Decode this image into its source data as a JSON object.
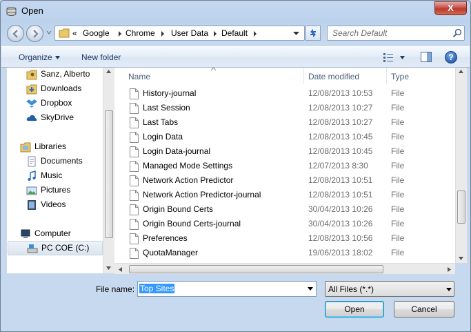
{
  "window": {
    "title": "Open",
    "close_glyph": "X"
  },
  "address": {
    "breadcrumb": [
      "«",
      "Google",
      "Chrome",
      "User Data",
      "Default"
    ]
  },
  "search": {
    "placeholder": "Search Default"
  },
  "toolbar": {
    "organize_label": "Organize",
    "new_folder_label": "New folder",
    "help_glyph": "?"
  },
  "nav": {
    "items": [
      {
        "label": "Sanz, Alberto",
        "icon": "user-folder-icon"
      },
      {
        "label": "Downloads",
        "icon": "downloads-icon"
      },
      {
        "label": "Dropbox",
        "icon": "dropbox-icon"
      },
      {
        "label": "SkyDrive",
        "icon": "skydrive-icon"
      },
      {
        "label": "Libraries",
        "icon": "libraries-icon"
      },
      {
        "label": "Documents",
        "icon": "documents-icon"
      },
      {
        "label": "Music",
        "icon": "music-icon"
      },
      {
        "label": "Pictures",
        "icon": "pictures-icon"
      },
      {
        "label": "Videos",
        "icon": "videos-icon"
      },
      {
        "label": "Computer",
        "icon": "computer-icon"
      },
      {
        "label": "PC COE (C:)",
        "icon": "drive-icon"
      }
    ]
  },
  "columns": {
    "name": "Name",
    "date": "Date modified",
    "type": "Type"
  },
  "files": [
    {
      "name": "History-journal",
      "date": "12/08/2013 10:53",
      "type": "File"
    },
    {
      "name": "Last Session",
      "date": "12/08/2013 10:27",
      "type": "File"
    },
    {
      "name": "Last Tabs",
      "date": "12/08/2013 10:27",
      "type": "File"
    },
    {
      "name": "Login Data",
      "date": "12/08/2013 10:45",
      "type": "File"
    },
    {
      "name": "Login Data-journal",
      "date": "12/08/2013 10:45",
      "type": "File"
    },
    {
      "name": "Managed Mode Settings",
      "date": "12/07/2013 8:30",
      "type": "File"
    },
    {
      "name": "Network Action Predictor",
      "date": "12/08/2013 10:51",
      "type": "File"
    },
    {
      "name": "Network Action Predictor-journal",
      "date": "12/08/2013 10:51",
      "type": "File"
    },
    {
      "name": "Origin Bound Certs",
      "date": "30/04/2013 10:26",
      "type": "File"
    },
    {
      "name": "Origin Bound Certs-journal",
      "date": "30/04/2013 10:26",
      "type": "File"
    },
    {
      "name": "Preferences",
      "date": "12/08/2013 10:56",
      "type": "File"
    },
    {
      "name": "QuotaManager",
      "date": "19/06/2013 18:02",
      "type": "File"
    }
  ],
  "bottom": {
    "filename_label": "File name:",
    "filename_value": "Top Sites",
    "filetype_value": "All Files (*.*)",
    "open_label": "Open",
    "cancel_label": "Cancel"
  }
}
